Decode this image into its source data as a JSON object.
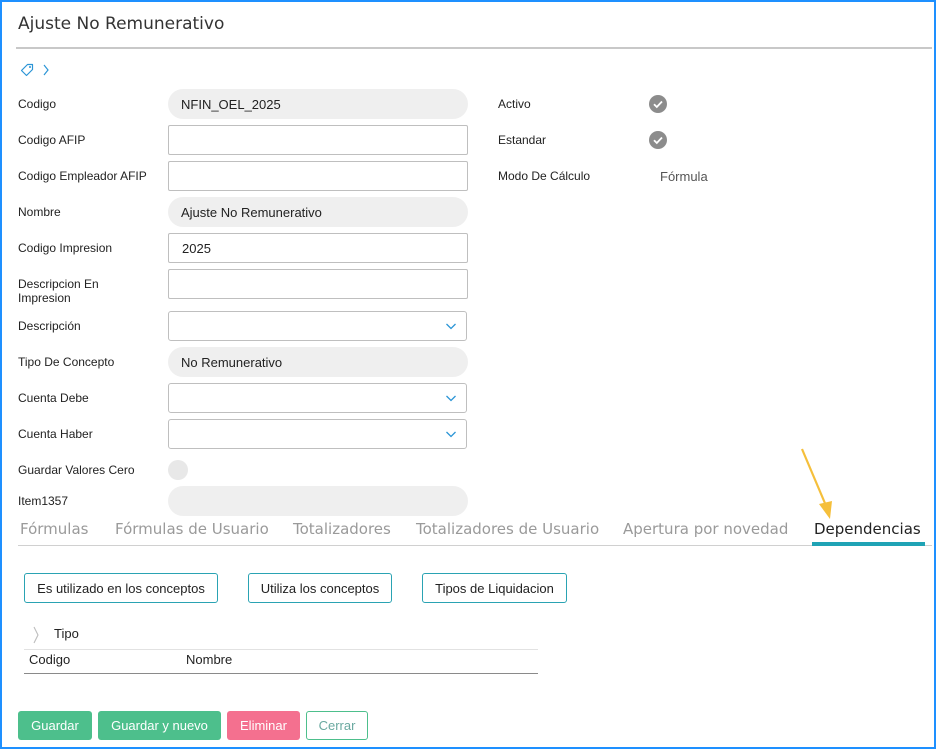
{
  "page": {
    "title": "Ajuste No Remunerativo"
  },
  "form": {
    "left": [
      {
        "label": "Codigo",
        "value": "NFIN_OEL_2025"
      },
      {
        "label": "Codigo AFIP",
        "value": ""
      },
      {
        "label": "Codigo Empleador AFIP",
        "value": ""
      },
      {
        "label": "Nombre",
        "value": "Ajuste No Remunerativo"
      },
      {
        "label": "Codigo Impresion",
        "value": "2025"
      },
      {
        "label": "Descripcion En Impresion",
        "value": ""
      },
      {
        "label": "Descripción",
        "value": ""
      },
      {
        "label": "Tipo De Concepto",
        "value": "No Remunerativo"
      },
      {
        "label": "Cuenta Debe",
        "value": ""
      },
      {
        "label": "Cuenta Haber",
        "value": ""
      },
      {
        "label": "Guardar Valores Cero"
      },
      {
        "label": "Item1357",
        "value": ""
      }
    ],
    "right": [
      {
        "label": "Activo"
      },
      {
        "label": "Estandar"
      },
      {
        "label": "Modo De Cálculo",
        "value": "Fórmula"
      }
    ]
  },
  "tabs": [
    {
      "label": "Fórmulas"
    },
    {
      "label": "Fórmulas de Usuario"
    },
    {
      "label": "Totalizadores"
    },
    {
      "label": "Totalizadores de Usuario"
    },
    {
      "label": "Apertura por novedad"
    },
    {
      "label": "Dependencias"
    }
  ],
  "active_tab": "Dependencias",
  "dependencias": {
    "buttons": [
      "Es utilizado en los conceptos",
      "Utiliza los conceptos",
      "Tipos de Liquidacion"
    ],
    "group_label": "Tipo",
    "columns": [
      "Codigo",
      "Nombre"
    ]
  },
  "footer": {
    "buttons": [
      "Guardar",
      "Guardar y nuevo",
      "Eliminar",
      "Cerrar"
    ]
  },
  "colors": {
    "accent": "#1fa3b5",
    "green": "#4dbf8c",
    "red": "#f4708f",
    "arrow": "#f5bf3b"
  }
}
